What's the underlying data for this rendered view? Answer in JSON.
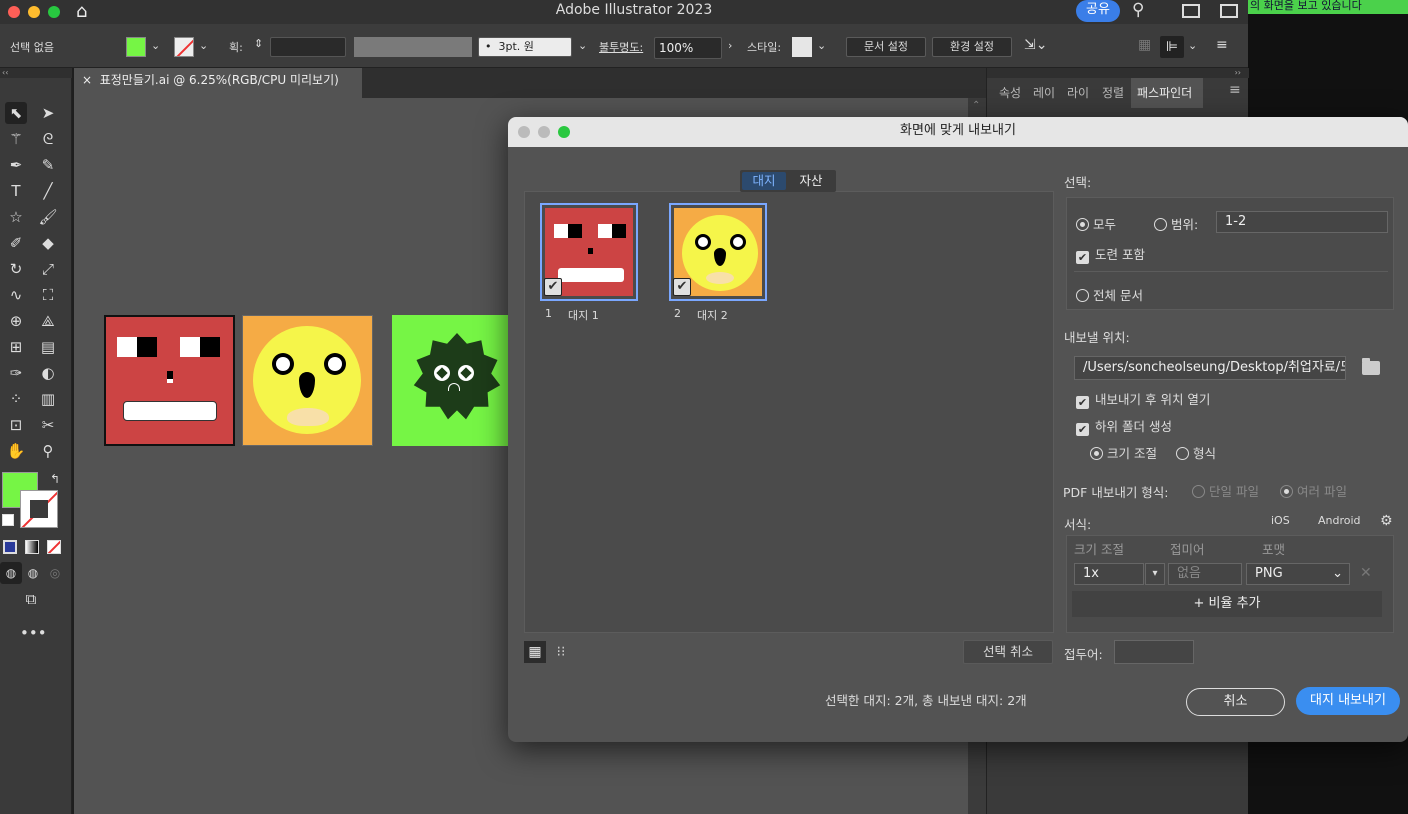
{
  "app": {
    "title": "Adobe Illustrator 2023",
    "share_label": "공유",
    "notice": "의 화면을 보고 있습니다"
  },
  "control_bar": {
    "selection": "선택 없음",
    "stroke_label": "획:",
    "brush_value": "3pt. 원",
    "opacity_label": "불투명도:",
    "opacity_value": "100%",
    "style_label": "스타일:",
    "doc_setup": "문서 설정",
    "preferences": "환경 설정"
  },
  "document_tab": {
    "close": "×",
    "label": "표정만들기.ai @ 6.25%(RGB/CPU 미리보기)"
  },
  "panel_tabs": [
    "속성",
    "레이",
    "라이",
    "정렬",
    "패스파인더"
  ],
  "dialog": {
    "title": "화면에 맞게 내보내기",
    "tabs": [
      "대지",
      "자산"
    ],
    "thumbnails": [
      {
        "num": "1",
        "name": "대지 1"
      },
      {
        "num": "2",
        "name": "대지 2"
      }
    ],
    "deselect": "선택 취소",
    "summary": "선택한 대지: 2개, 총 내보낸 대지: 2개",
    "selection_heading": "선택:",
    "all": "모두",
    "range": "범위:",
    "range_value": "1-2",
    "include_bleed": "도련 포함",
    "full_document": "전체 문서",
    "export_to": "내보낼 위치:",
    "path": "/Users/soncheolseung/Desktop/취업자료/도",
    "open_after": "내보내기 후 위치 열기",
    "create_subfolders": "하위 폴더 생성",
    "scale": "크기 조절",
    "format_opt": "형식",
    "pdf_label": "PDF 내보내기 형식:",
    "single_file": "단일 파일",
    "multi_file": "여러 파일",
    "formats_heading": "서식:",
    "ios": "iOS",
    "android": "Android",
    "col_scale": "크기 조절",
    "col_suffix": "접미어",
    "col_format": "포맷",
    "row_scale": "1x",
    "row_suffix_placeholder": "없음",
    "row_format": "PNG",
    "add_scale": "+ 비율 추가",
    "prefix_label": "접두어:",
    "cancel": "취소",
    "export_button": "대지 내보내기"
  },
  "colors": {
    "accent": "#3a7ee8",
    "red_face": "#cc4444",
    "orange_bg": "#f5ab45",
    "yellow_face": "#f5f54a",
    "green_bg": "#76f545",
    "dark_green": "#1d3c19"
  },
  "icons": [
    "home-icon",
    "search-icon",
    "folder-icon",
    "gear-icon",
    "checkmark-icon"
  ]
}
